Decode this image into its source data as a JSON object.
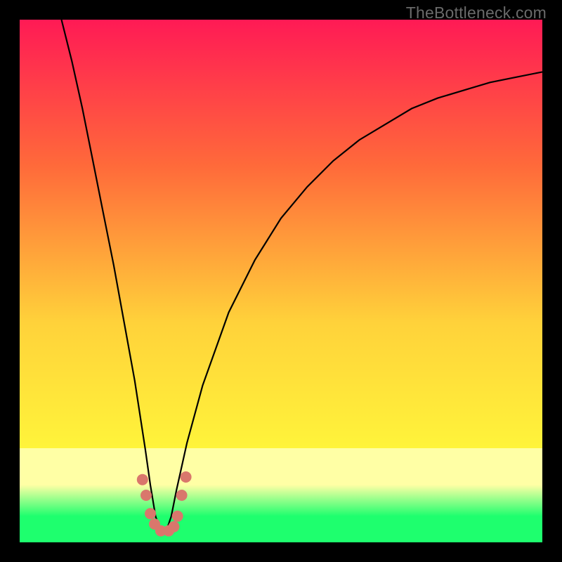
{
  "watermark": "TheBottleneck.com",
  "chart_data": {
    "type": "line",
    "title": "",
    "xlabel": "",
    "ylabel": "",
    "xlim": [
      0,
      100
    ],
    "ylim": [
      0,
      100
    ],
    "gradient_colors": {
      "top": "#ff1a55",
      "upper_mid": "#ff6a3a",
      "mid": "#ffd23a",
      "lower_mid": "#fff43a",
      "band_pale": "#ffffa5",
      "bottom": "#1eff6e"
    },
    "series": [
      {
        "name": "bottleneck-curve",
        "description": "V-shaped curve; higher y = worse (red), dip near x≈27 reaches optimum (green band).",
        "x": [
          8,
          10,
          12,
          14,
          16,
          18,
          20,
          22,
          24,
          25,
          26,
          27,
          28,
          29,
          30,
          32,
          35,
          40,
          45,
          50,
          55,
          60,
          65,
          70,
          75,
          80,
          85,
          90,
          95,
          100
        ],
        "y": [
          100,
          92,
          83,
          73,
          63,
          53,
          42,
          31,
          18,
          11,
          5,
          2,
          2,
          5,
          10,
          19,
          30,
          44,
          54,
          62,
          68,
          73,
          77,
          80,
          83,
          85,
          86.5,
          88,
          89,
          90
        ]
      }
    ],
    "markers": {
      "description": "Salmon dot cluster near curve minimum",
      "color": "#d9776c",
      "points": [
        {
          "x": 23.5,
          "y": 12
        },
        {
          "x": 24.2,
          "y": 9
        },
        {
          "x": 25.0,
          "y": 5.5
        },
        {
          "x": 25.8,
          "y": 3.5
        },
        {
          "x": 27.0,
          "y": 2.2
        },
        {
          "x": 28.5,
          "y": 2.2
        },
        {
          "x": 29.5,
          "y": 3.0
        },
        {
          "x": 30.2,
          "y": 5.0
        },
        {
          "x": 31.0,
          "y": 9.0
        },
        {
          "x": 31.8,
          "y": 12.5
        }
      ]
    }
  }
}
